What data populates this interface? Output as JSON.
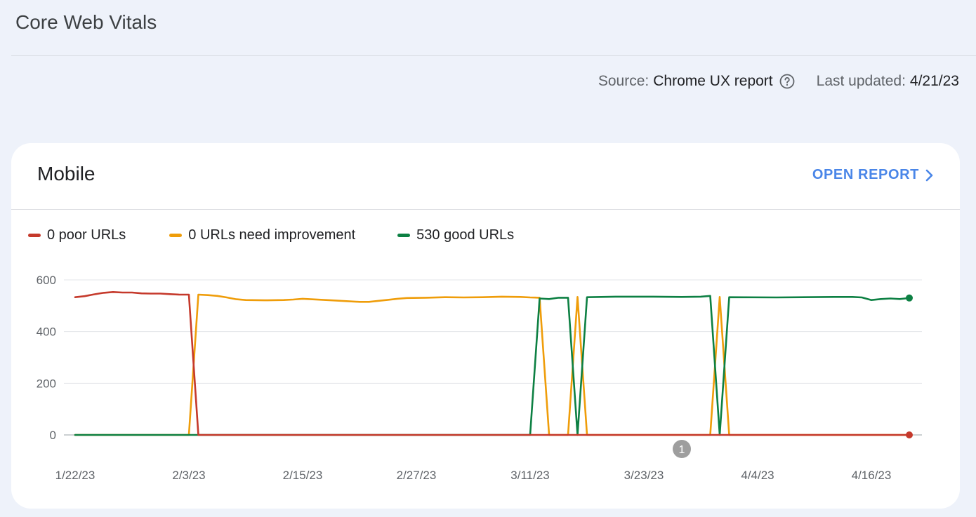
{
  "page": {
    "title": "Core Web Vitals",
    "source_label": "Source:",
    "source_value": "Chrome UX report",
    "help_icon": "help-circle-icon",
    "updated_label": "Last updated:",
    "updated_value": "4/21/23"
  },
  "card": {
    "title": "Mobile",
    "open_report_label": "OPEN REPORT",
    "open_report_icon": "chevron-right-icon"
  },
  "colors": {
    "poor": "#c5392b",
    "needs_improvement": "#ef9d0a",
    "good": "#0d8043",
    "link": "#4a86e8"
  },
  "legend": [
    {
      "label": "0 poor URLs",
      "color": "#c5392b"
    },
    {
      "label": "0 URLs need improvement",
      "color": "#ef9d0a"
    },
    {
      "label": "530 good URLs",
      "color": "#0d8043"
    }
  ],
  "chart_data": {
    "type": "line",
    "x_tick_labels": [
      "1/22/23",
      "2/3/23",
      "2/15/23",
      "2/27/23",
      "3/11/23",
      "3/23/23",
      "4/4/23",
      "4/16/23"
    ],
    "y_ticks": [
      0,
      200,
      400,
      600
    ],
    "ylim": [
      0,
      600
    ],
    "x_start": "1/22/23",
    "x_end": "4/20/23",
    "grid": true,
    "legend_position": "top-left",
    "annotations": [
      {
        "label": "1",
        "x": "3/27/23"
      }
    ],
    "series": [
      {
        "name": "0 poor URLs",
        "color": "#c5392b",
        "x": [
          "1/22/23",
          "1/23/23",
          "1/24/23",
          "1/25/23",
          "1/26/23",
          "1/27/23",
          "1/28/23",
          "1/29/23",
          "1/30/23",
          "1/31/23",
          "2/1/23",
          "2/2/23",
          "2/3/23",
          "2/4/23",
          "2/20/23",
          "3/10/23",
          "4/20/23"
        ],
        "values": [
          533,
          537,
          544,
          550,
          553,
          551,
          551,
          548,
          547,
          547,
          545,
          543,
          543,
          0,
          0,
          0,
          0
        ]
      },
      {
        "name": "0 URLs need improvement",
        "color": "#ef9d0a",
        "x": [
          "1/22/23",
          "2/2/23",
          "2/3/23",
          "2/4/23",
          "2/5/23",
          "2/6/23",
          "2/7/23",
          "2/8/23",
          "2/9/23",
          "2/11/23",
          "2/13/23",
          "2/14/23",
          "2/15/23",
          "2/18/23",
          "2/21/23",
          "2/22/23",
          "2/24/23",
          "2/25/23",
          "2/26/23",
          "2/28/23",
          "3/2/23",
          "3/4/23",
          "3/6/23",
          "3/8/23",
          "3/10/23",
          "3/11/23",
          "3/12/23",
          "3/13/23",
          "3/14/23",
          "3/15/23",
          "3/16/23",
          "3/17/23",
          "3/18/23",
          "3/30/23",
          "3/31/23",
          "4/1/23",
          "4/2/23",
          "4/20/23"
        ],
        "values": [
          0,
          0,
          0,
          543,
          541,
          538,
          532,
          525,
          522,
          521,
          522,
          524,
          527,
          521,
          515,
          515,
          523,
          527,
          530,
          531,
          533,
          532,
          533,
          535,
          534,
          532,
          531,
          0,
          0,
          0,
          534,
          0,
          0,
          0,
          534,
          0,
          0,
          0
        ]
      },
      {
        "name": "530 good URLs",
        "color": "#0d8043",
        "x": [
          "1/22/23",
          "3/11/23",
          "3/12/23",
          "3/13/23",
          "3/14/23",
          "3/15/23",
          "3/16/23",
          "3/17/23",
          "3/20/23",
          "3/24/23",
          "3/27/23",
          "3/29/23",
          "3/30/23",
          "3/31/23",
          "4/1/23",
          "4/6/23",
          "4/12/23",
          "4/14/23",
          "4/15/23",
          "4/16/23",
          "4/17/23",
          "4/18/23",
          "4/19/23",
          "4/20/23"
        ],
        "values": [
          0,
          0,
          528,
          526,
          531,
          531,
          0,
          533,
          535,
          535,
          534,
          535,
          538,
          0,
          533,
          532,
          534,
          534,
          532,
          522,
          526,
          528,
          526,
          530
        ]
      }
    ]
  }
}
